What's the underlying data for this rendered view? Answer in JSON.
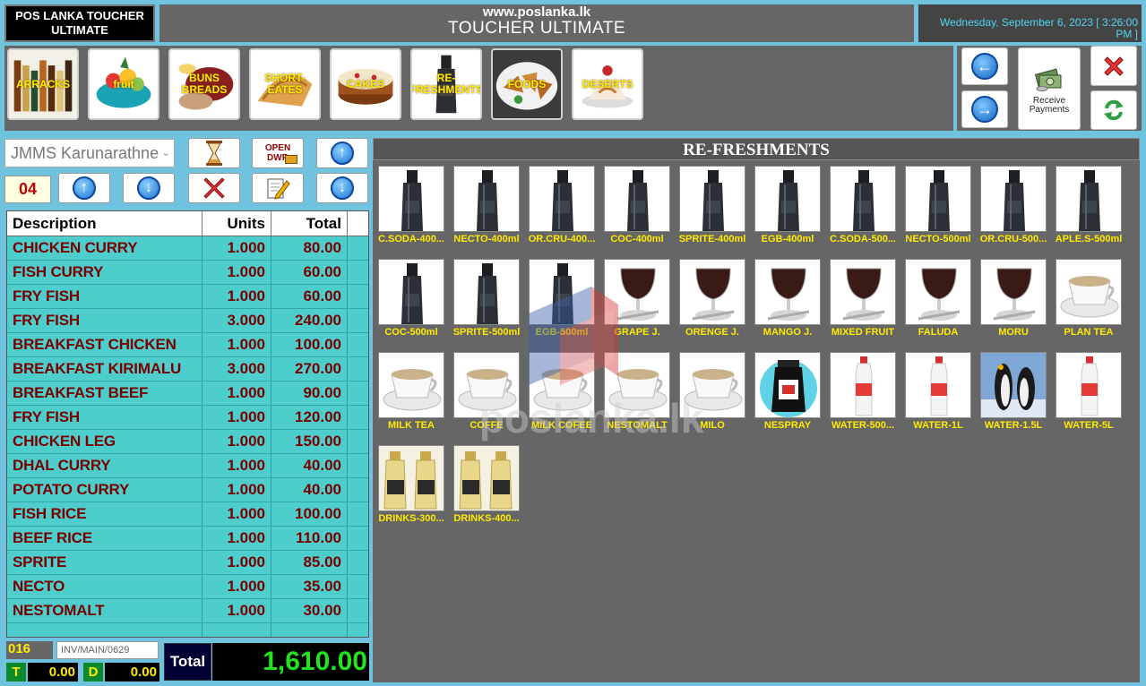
{
  "header": {
    "brand": "POS LANKA TOUCHER ULTIMATE",
    "url": "www.poslanka.lk",
    "app_name": "TOUCHER ULTIMATE",
    "datetime": "Wednesday, September 6, 2023 [ 3:26:00 PM ]"
  },
  "categories": [
    {
      "label": "ARRACKS",
      "icon": "bottles-image"
    },
    {
      "label": "fruit",
      "icon": "fruit-bowl-image"
    },
    {
      "label": "BUNS BREADS",
      "icon": "bread-image"
    },
    {
      "label": "SHORT-EATES",
      "icon": "pastry-image"
    },
    {
      "label": "CAKES",
      "icon": "cake-image"
    },
    {
      "label": "RE-FRESHMENTS",
      "icon": "soda-bottle-image"
    },
    {
      "label": "FOODS",
      "icon": "food-plate-image"
    },
    {
      "label": "DESERTS",
      "icon": "dessert-image"
    }
  ],
  "controls": {
    "receive_payments": "Receive Payments",
    "open_drawer": "OPEN DWR"
  },
  "order": {
    "customer": "JMMS Karunarathne",
    "table_no": "04",
    "columns": [
      "Description",
      "Units",
      "Total"
    ],
    "rows": [
      {
        "desc": "CHICKEN CURRY",
        "units": "1.000",
        "total": "80.00"
      },
      {
        "desc": "FISH CURRY",
        "units": "1.000",
        "total": "60.00"
      },
      {
        "desc": "FRY FISH",
        "units": "1.000",
        "total": "60.00"
      },
      {
        "desc": "FRY FISH",
        "units": "3.000",
        "total": "240.00"
      },
      {
        "desc": "BREAKFAST CHICKEN",
        "units": "1.000",
        "total": "100.00"
      },
      {
        "desc": "BREAKFAST KIRIMALU",
        "units": "3.000",
        "total": "270.00"
      },
      {
        "desc": "BREAKFAST BEEF",
        "units": "1.000",
        "total": "90.00"
      },
      {
        "desc": "FRY FISH",
        "units": "1.000",
        "total": "120.00"
      },
      {
        "desc": "CHICKEN LEG",
        "units": "1.000",
        "total": "150.00"
      },
      {
        "desc": "DHAL CURRY",
        "units": "1.000",
        "total": "40.00"
      },
      {
        "desc": "POTATO CURRY",
        "units": "1.000",
        "total": "40.00"
      },
      {
        "desc": "FISH RICE",
        "units": "1.000",
        "total": "100.00"
      },
      {
        "desc": "BEEF RICE",
        "units": "1.000",
        "total": "110.00"
      },
      {
        "desc": "SPRITE",
        "units": "1.000",
        "total": "85.00"
      },
      {
        "desc": "NECTO",
        "units": "1.000",
        "total": "35.00"
      },
      {
        "desc": "NESTOMALT",
        "units": "1.000",
        "total": "30.00"
      }
    ]
  },
  "footer": {
    "item_count": "016",
    "invoice_no": "INV/MAIN/0629",
    "t_label": "T",
    "t_value": "0.00",
    "d_label": "D",
    "d_value": "0.00",
    "total_label": "Total",
    "total_value": "1,610.00"
  },
  "items_title": "RE-FRESHMENTS",
  "items": [
    {
      "name": "C.SODA-400...",
      "kind": "bottle"
    },
    {
      "name": "NECTO-400ml",
      "kind": "bottle"
    },
    {
      "name": "OR.CRU-400...",
      "kind": "bottle"
    },
    {
      "name": "COC-400ml",
      "kind": "bottle"
    },
    {
      "name": "SPRITE-400ml",
      "kind": "bottle"
    },
    {
      "name": "EGB-400ml",
      "kind": "bottle"
    },
    {
      "name": "C.SODA-500...",
      "kind": "bottle"
    },
    {
      "name": "NECTO-500ml",
      "kind": "bottle"
    },
    {
      "name": "OR.CRU-500...",
      "kind": "bottle"
    },
    {
      "name": "APLE.S-500ml",
      "kind": "bottle"
    },
    {
      "name": "COC-500ml",
      "kind": "bottle"
    },
    {
      "name": "SPRITE-500ml",
      "kind": "bottle"
    },
    {
      "name": "EGB-500ml",
      "kind": "bottle"
    },
    {
      "name": "GRAPE J.",
      "kind": "juice"
    },
    {
      "name": "ORENGE J.",
      "kind": "juice"
    },
    {
      "name": "MANGO J.",
      "kind": "juice"
    },
    {
      "name": "MIXED FRUIT",
      "kind": "juice"
    },
    {
      "name": "FALUDA",
      "kind": "juice"
    },
    {
      "name": "MORU",
      "kind": "juice"
    },
    {
      "name": "PLAN TEA",
      "kind": "cup"
    },
    {
      "name": "MILK TEA",
      "kind": "cup"
    },
    {
      "name": "COFFE",
      "kind": "cup"
    },
    {
      "name": "MILK COFEE",
      "kind": "cup"
    },
    {
      "name": "NESTOMALT",
      "kind": "cup"
    },
    {
      "name": "MILO",
      "kind": "cup"
    },
    {
      "name": "NESPRAY",
      "kind": "tin"
    },
    {
      "name": "WATER-500...",
      "kind": "water"
    },
    {
      "name": "WATER-1L",
      "kind": "water"
    },
    {
      "name": "WATER-1.5L",
      "kind": "penguins"
    },
    {
      "name": "WATER-5L",
      "kind": "water"
    },
    {
      "name": "DRINKS-300...",
      "kind": "twin"
    },
    {
      "name": "DRINKS-400...",
      "kind": "twin"
    }
  ],
  "watermark": "poslanka.lk"
}
